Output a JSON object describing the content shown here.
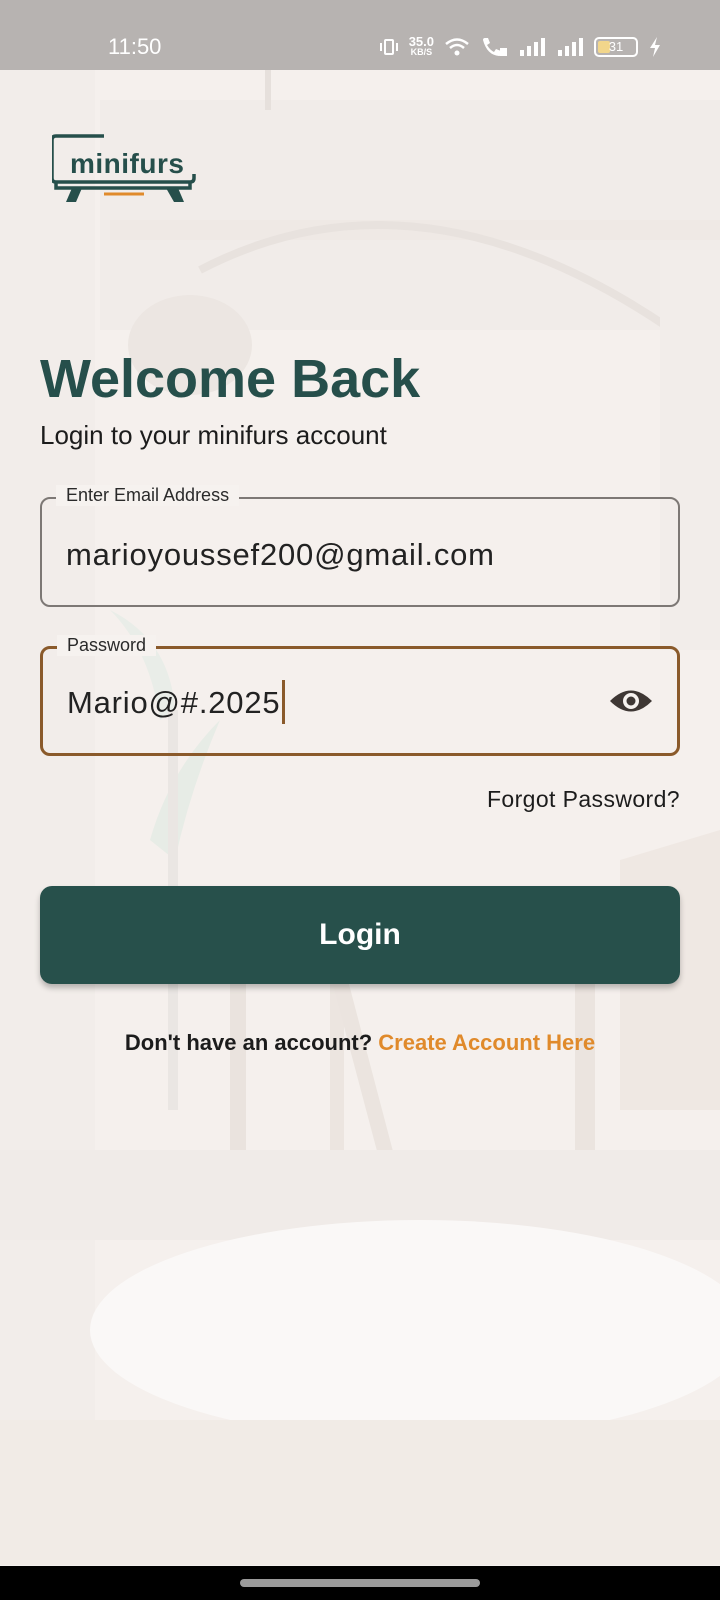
{
  "status_bar": {
    "time": "11:50",
    "net_speed": "35.0",
    "net_unit": "KB/S",
    "battery_level": "31",
    "icons": [
      "vibrate-icon",
      "wifi-icon",
      "wifi-call-icon",
      "signal-icon",
      "signal-icon",
      "battery-icon",
      "charging-icon"
    ]
  },
  "logo": {
    "text": "minifurs"
  },
  "header": {
    "title": "Welcome Back",
    "subtitle": "Login to your minifurs account"
  },
  "form": {
    "email": {
      "label": "Enter Email Address",
      "value": "marioyoussef200@gmail.com"
    },
    "password": {
      "label": "Password",
      "value": "Mario@#.2025",
      "toggle_icon": "eye-icon"
    },
    "forgot_label": "Forgot Password?",
    "login_label": "Login"
  },
  "signup": {
    "question": "Don't have an account?",
    "link": "Create Account Here"
  },
  "colors": {
    "primary": "#27504b",
    "accent": "#e08a2b",
    "focus_border": "#8a5a2b"
  }
}
